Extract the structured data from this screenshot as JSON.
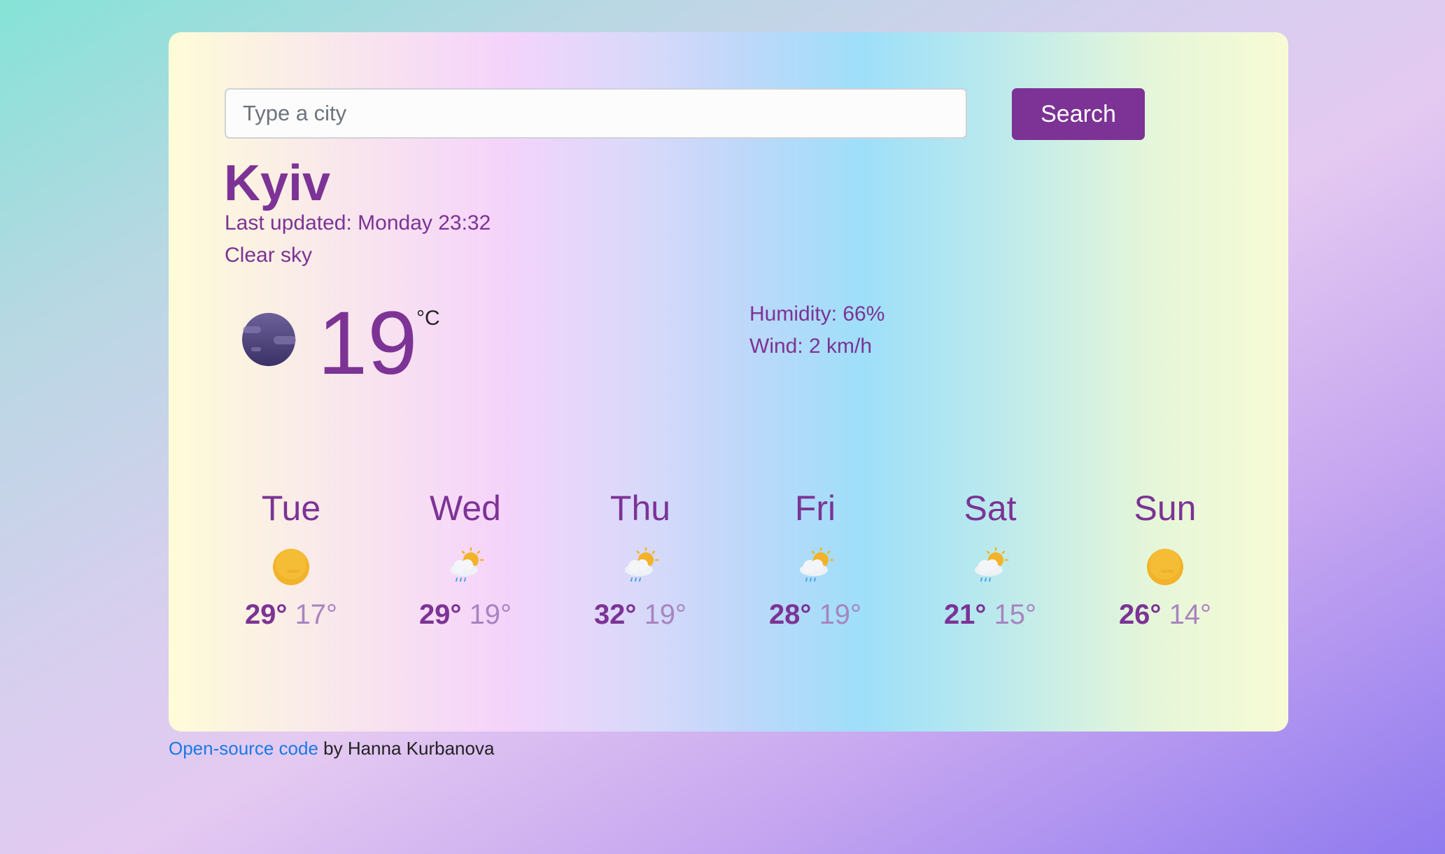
{
  "search": {
    "placeholder": "Type a city",
    "value": "",
    "button_label": "Search"
  },
  "current": {
    "city": "Kyiv",
    "last_updated": "Last updated: Monday 23:32",
    "description": "Clear sky",
    "temperature": "19",
    "unit": "°C",
    "icon": "moon-icon",
    "humidity": "Humidity: 66%",
    "wind": "Wind: 2 km/h"
  },
  "forecast": [
    {
      "day": "Tue",
      "icon": "sun-icon",
      "max": "29°",
      "min": "17°"
    },
    {
      "day": "Wed",
      "icon": "rain-sun-cloud-icon",
      "max": "29°",
      "min": "19°"
    },
    {
      "day": "Thu",
      "icon": "rain-sun-cloud-icon",
      "max": "32°",
      "min": "19°"
    },
    {
      "day": "Fri",
      "icon": "rain-sun-cloud-icon",
      "max": "28°",
      "min": "19°"
    },
    {
      "day": "Sat",
      "icon": "rain-sun-cloud-icon",
      "max": "21°",
      "min": "15°"
    },
    {
      "day": "Sun",
      "icon": "sun-icon",
      "max": "26°",
      "min": "14°"
    }
  ],
  "footer": {
    "link_text": "Open-source code",
    "credit": " by Hanna Kurbanova"
  },
  "colors": {
    "accent": "#7c3395",
    "link": "#1979e6",
    "min_temp": "#a784c0"
  }
}
